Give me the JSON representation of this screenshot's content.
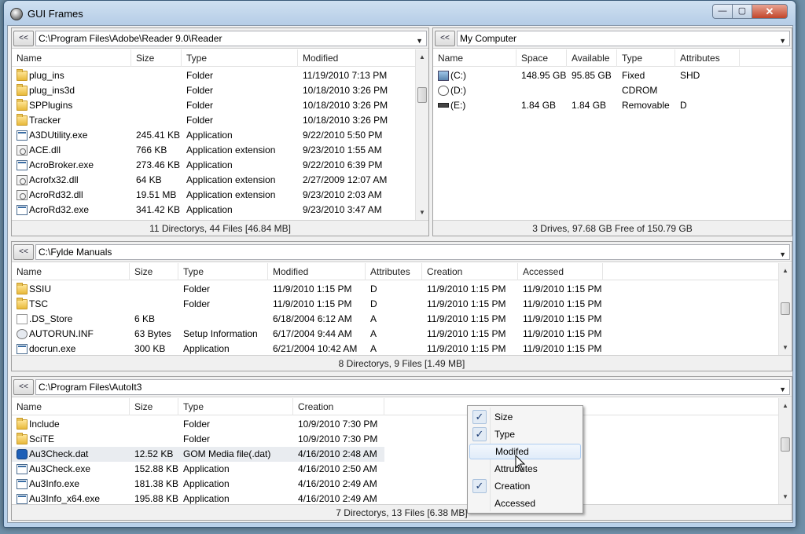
{
  "window": {
    "title": "GUI Frames",
    "min": "—",
    "max": "▢",
    "close": "✕"
  },
  "frames": [
    {
      "back_label": "<<",
      "path": "C:\\Program Files\\Adobe\\Reader 9.0\\Reader",
      "columns": [
        "Name",
        "Size",
        "Type",
        "Modified"
      ],
      "rows": [
        {
          "icon": "folder",
          "name": "plug_ins",
          "size": "",
          "type": "Folder",
          "modified": "11/19/2010 7:13 PM"
        },
        {
          "icon": "folder",
          "name": "plug_ins3d",
          "size": "",
          "type": "Folder",
          "modified": "10/18/2010 3:26 PM"
        },
        {
          "icon": "folder",
          "name": "SPPlugins",
          "size": "",
          "type": "Folder",
          "modified": "10/18/2010 3:26 PM"
        },
        {
          "icon": "folder",
          "name": "Tracker",
          "size": "",
          "type": "Folder",
          "modified": "10/18/2010 3:26 PM"
        },
        {
          "icon": "exe",
          "name": "A3DUtility.exe",
          "size": "245.41 KB",
          "type": "Application",
          "modified": "9/22/2010 5:50 PM"
        },
        {
          "icon": "dll",
          "name": "ACE.dll",
          "size": "766 KB",
          "type": "Application extension",
          "modified": "9/23/2010 1:55 AM"
        },
        {
          "icon": "exe",
          "name": "AcroBroker.exe",
          "size": "273.46 KB",
          "type": "Application",
          "modified": "9/22/2010 6:39 PM"
        },
        {
          "icon": "dll",
          "name": "Acrofx32.dll",
          "size": "64 KB",
          "type": "Application extension",
          "modified": "2/27/2009 12:07 AM"
        },
        {
          "icon": "dll",
          "name": "AcroRd32.dll",
          "size": "19.51 MB",
          "type": "Application extension",
          "modified": "9/23/2010 2:03 AM"
        },
        {
          "icon": "exe",
          "name": "AcroRd32.exe",
          "size": "341.42 KB",
          "type": "Application",
          "modified": "9/23/2010 3:47 AM"
        }
      ],
      "status": "11 Directorys, 44 Files [46.84 MB]"
    },
    {
      "back_label": "<<",
      "path": "My Computer",
      "columns": [
        "Name",
        "Space",
        "Available",
        "Type",
        "Attributes"
      ],
      "rows": [
        {
          "icon": "drivec",
          "name": "(C:)",
          "space": "148.95 GB",
          "available": "95.85 GB",
          "type": "Fixed",
          "attributes": "SHD"
        },
        {
          "icon": "drivecd",
          "name": "(D:)",
          "space": "",
          "available": "",
          "type": "CDROM",
          "attributes": ""
        },
        {
          "icon": "drivee",
          "name": "(E:)",
          "space": "1.84 GB",
          "available": "1.84 GB",
          "type": "Removable",
          "attributes": "D"
        }
      ],
      "status": "3 Drives, 97.68 GB Free of 150.79 GB"
    },
    {
      "back_label": "<<",
      "path": "C:\\Fylde Manuals",
      "columns": [
        "Name",
        "Size",
        "Type",
        "Modified",
        "Attributes",
        "Creation",
        "Accessed"
      ],
      "rows": [
        {
          "icon": "folder",
          "name": "SSIU",
          "size": "",
          "type": "Folder",
          "modified": "11/9/2010 1:15 PM",
          "attributes": "D",
          "creation": "11/9/2010 1:15 PM",
          "accessed": "11/9/2010 1:15 PM"
        },
        {
          "icon": "folder",
          "name": "TSC",
          "size": "",
          "type": "Folder",
          "modified": "11/9/2010 1:15 PM",
          "attributes": "D",
          "creation": "11/9/2010 1:15 PM",
          "accessed": "11/9/2010 1:15 PM"
        },
        {
          "icon": "file",
          "name": ".DS_Store",
          "size": "6 KB",
          "type": "",
          "modified": "6/18/2004 6:12 AM",
          "attributes": "A",
          "creation": "11/9/2010 1:15 PM",
          "accessed": "11/9/2010 1:15 PM"
        },
        {
          "icon": "inf",
          "name": "AUTORUN.INF",
          "size": "63 Bytes",
          "type": "Setup Information",
          "modified": "6/17/2004 9:44 AM",
          "attributes": "A",
          "creation": "11/9/2010 1:15 PM",
          "accessed": "11/9/2010 1:15 PM"
        },
        {
          "icon": "exe",
          "name": "docrun.exe",
          "size": "300 KB",
          "type": "Application",
          "modified": "6/21/2004 10:42 AM",
          "attributes": "A",
          "creation": "11/9/2010 1:15 PM",
          "accessed": "11/9/2010 1:15 PM"
        }
      ],
      "status": "8 Directorys, 9 Files [1.49 MB]"
    },
    {
      "back_label": "<<",
      "path": "C:\\Program Files\\AutoIt3",
      "columns": [
        "Name",
        "Size",
        "Type",
        "Creation"
      ],
      "rows": [
        {
          "icon": "folder",
          "name": "Include",
          "size": "",
          "type": "Folder",
          "creation": "10/9/2010 7:30 PM"
        },
        {
          "icon": "folder",
          "name": "SciTE",
          "size": "",
          "type": "Folder",
          "creation": "10/9/2010 7:30 PM"
        },
        {
          "icon": "dat",
          "name": "Au3Check.dat",
          "size": "12.52 KB",
          "type": "GOM Media file(.dat)",
          "creation": "4/16/2010 2:48 AM"
        },
        {
          "icon": "exe",
          "name": "Au3Check.exe",
          "size": "152.88 KB",
          "type": "Application",
          "creation": "4/16/2010 2:50 AM"
        },
        {
          "icon": "exe",
          "name": "Au3Info.exe",
          "size": "181.38 KB",
          "type": "Application",
          "creation": "4/16/2010 2:49 AM"
        },
        {
          "icon": "exe",
          "name": "Au3Info_x64.exe",
          "size": "195.88 KB",
          "type": "Application",
          "creation": "4/16/2010 2:49 AM"
        }
      ],
      "status": "7 Directorys, 13 Files [6.38 MB]"
    }
  ],
  "context_menu": {
    "items": [
      {
        "label": "Size",
        "checked": true
      },
      {
        "label": "Type",
        "checked": true
      },
      {
        "label": "Modifed",
        "checked": false,
        "hover": true
      },
      {
        "label": "Attrubutes",
        "checked": false
      },
      {
        "label": "Creation",
        "checked": true
      },
      {
        "label": "Accessed",
        "checked": false
      }
    ]
  }
}
